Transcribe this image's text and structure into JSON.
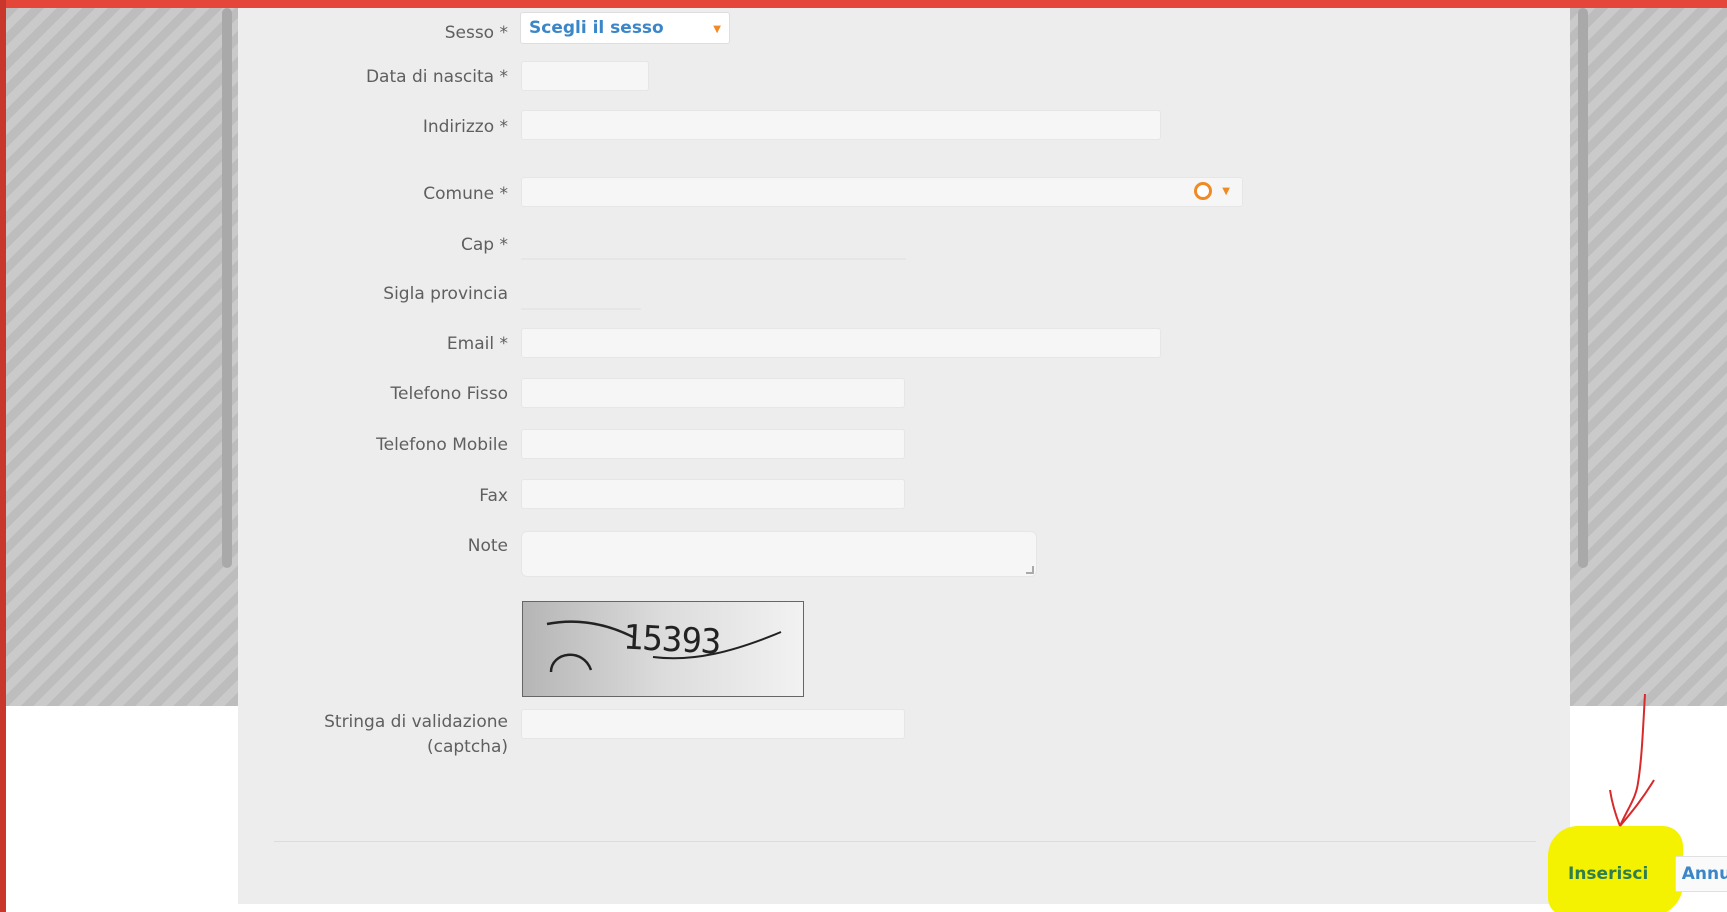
{
  "form": {
    "sesso": {
      "label": "Sesso *",
      "value": "Scegli il sesso"
    },
    "data_nascita": {
      "label": "Data di nascita *",
      "value": ""
    },
    "indirizzo": {
      "label": "Indirizzo *",
      "value": ""
    },
    "comune": {
      "label": "Comune *",
      "value": ""
    },
    "cap": {
      "label": "Cap *",
      "value": ""
    },
    "sigla_provincia": {
      "label": "Sigla provincia",
      "value": ""
    },
    "email": {
      "label": "Email *",
      "value": ""
    },
    "telefono_fisso": {
      "label": "Telefono Fisso",
      "value": ""
    },
    "telefono_mobile": {
      "label": "Telefono Mobile",
      "value": ""
    },
    "fax": {
      "label": "Fax",
      "value": ""
    },
    "note": {
      "label": "Note",
      "value": ""
    },
    "captcha_image_text": "15393",
    "captcha": {
      "label_line1": "Stringa di validazione",
      "label_line2": "(captcha)",
      "value": ""
    }
  },
  "actions": {
    "insert_label": "Inserisci",
    "cancel_label": "Annulla"
  },
  "colors": {
    "frame_accent": "#e4473a",
    "link_blue": "#3a86c8",
    "highlight_yellow": "#f4f200",
    "annotation_red": "#d82a2a"
  },
  "icons": {
    "select_caret": "chevron-down-icon",
    "combo_clear": "clear-icon",
    "combo_caret": "chevron-down-icon"
  }
}
